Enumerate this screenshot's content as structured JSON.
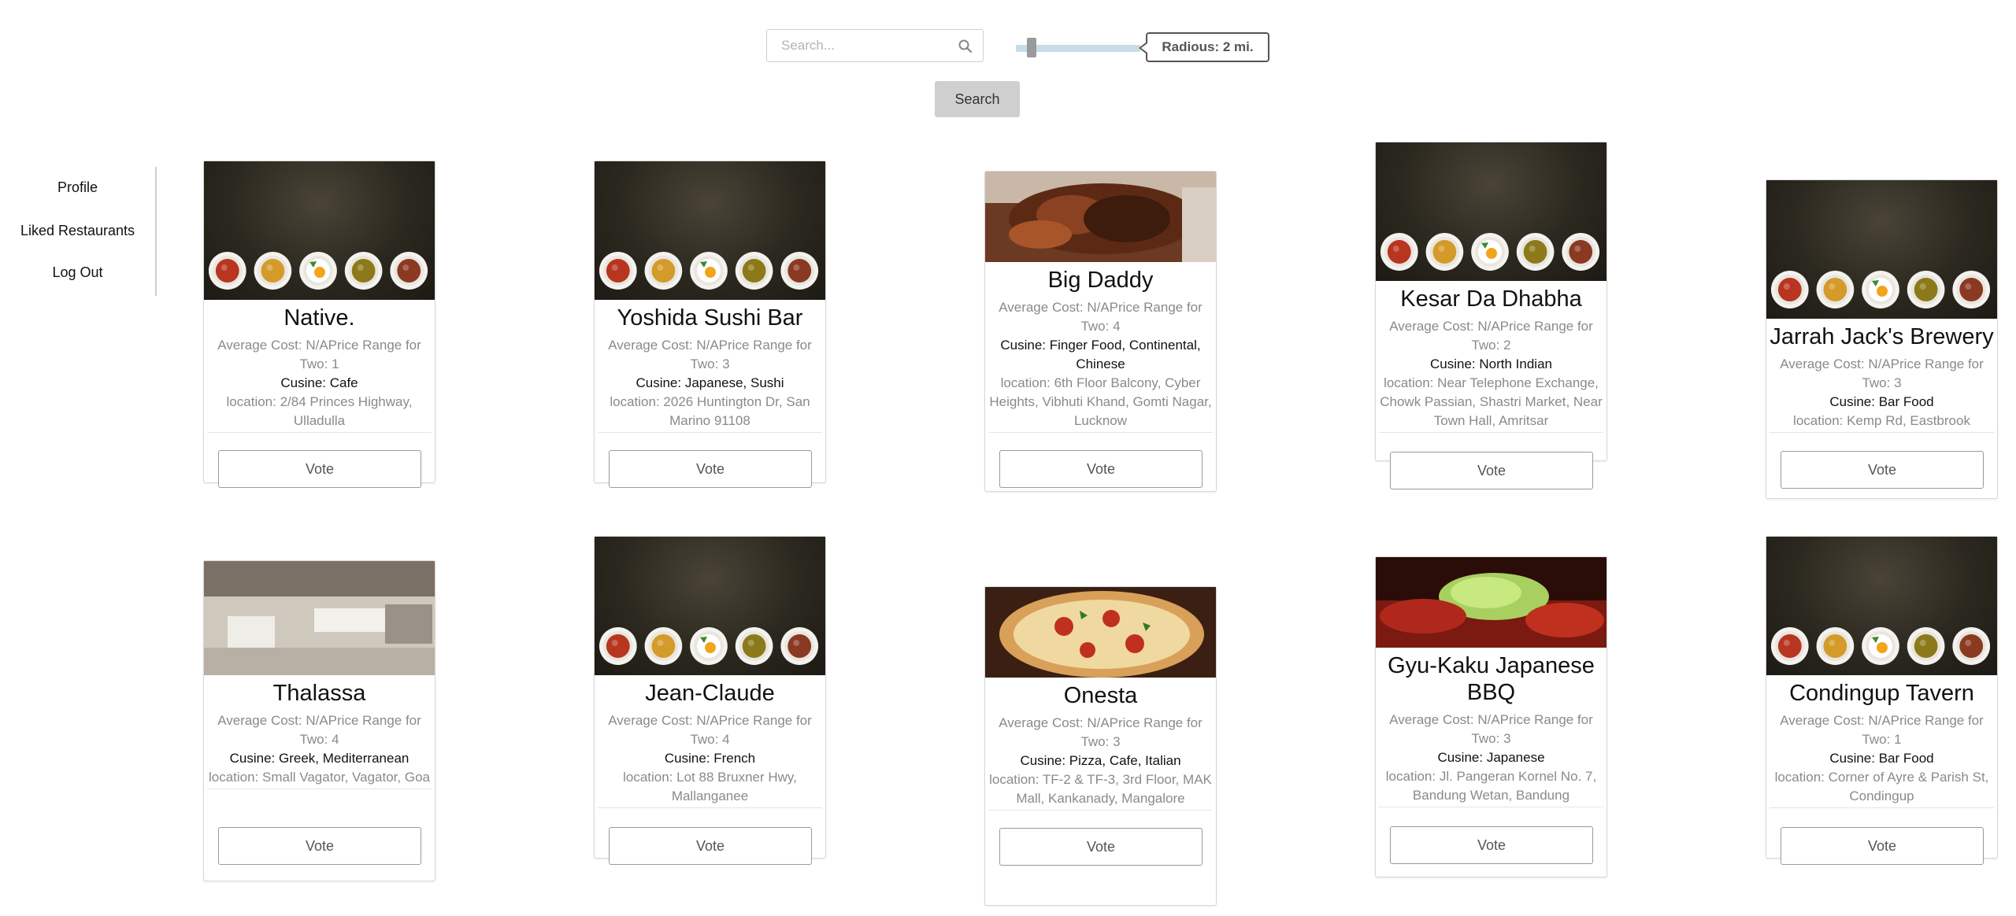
{
  "search": {
    "placeholder": "Search...",
    "button_label": "Search"
  },
  "radius": {
    "label": "Radious: 2 mi.",
    "value": 2
  },
  "sidebar": {
    "items": [
      {
        "label": "Profile"
      },
      {
        "label": "Liked Restaurants"
      },
      {
        "label": "Log Out"
      }
    ]
  },
  "cards": [
    {
      "name": "Native.",
      "cost": "Average Cost: N/APrice Range for Two: 1",
      "cuisine": "Cusine: Cafe",
      "location": "location: 2/84 Princes Highway, Ulladulla",
      "vote_label": "Vote",
      "image": "dark-plates"
    },
    {
      "name": "Yoshida Sushi Bar",
      "cost": "Average Cost: N/APrice Range for Two: 3",
      "cuisine": "Cusine: Japanese, Sushi",
      "location": "location: 2026 Huntington Dr, San Marino 91108",
      "vote_label": "Vote",
      "image": "dark-plates"
    },
    {
      "name": "Big Daddy",
      "cost": "Average Cost: N/APrice Range for Two: 4",
      "cuisine": "Cusine: Finger Food, Continental, Chinese",
      "location": "location: 6th Floor Balcony, Cyber Heights, Vibhuti Khand, Gomti Nagar, Lucknow",
      "vote_label": "Vote",
      "image": "meat-photo"
    },
    {
      "name": "Kesar Da Dhabha",
      "cost": "Average Cost: N/APrice Range for Two: 2",
      "cuisine": "Cusine: North Indian",
      "location": "location: Near Telephone Exchange, Chowk Passian, Shastri Market, Near Town Hall, Amritsar",
      "vote_label": "Vote",
      "image": "dark-plates"
    },
    {
      "name": "Jarrah Jack's Brewery",
      "cost": "Average Cost: N/APrice Range for Two: 3",
      "cuisine": "Cusine: Bar Food",
      "location": "location: Kemp Rd, Eastbrook",
      "vote_label": "Vote",
      "image": "dark-plates"
    },
    {
      "name": "Thalassa",
      "cost": "Average Cost: N/APrice Range for Two: 4",
      "cuisine": "Cusine: Greek, Mediterranean",
      "location": "location: Small Vagator, Vagator, Goa",
      "vote_label": "Vote",
      "image": "terrace-photo"
    },
    {
      "name": "Jean-Claude",
      "cost": "Average Cost: N/APrice Range for Two: 4",
      "cuisine": "Cusine: French",
      "location": "location: Lot 88 Bruxner Hwy, Mallanganee",
      "vote_label": "Vote",
      "image": "dark-plates"
    },
    {
      "name": "Onesta",
      "cost": "Average Cost: N/APrice Range for Two: 3",
      "cuisine": "Cusine: Pizza, Cafe, Italian",
      "location": "location: TF-2 & TF-3, 3rd Floor, MAK Mall, Kankanady, Mangalore",
      "vote_label": "Vote",
      "image": "pizza-photo"
    },
    {
      "name": "Gyu-Kaku Japanese BBQ",
      "cost": "Average Cost: N/APrice Range for Two: 3",
      "cuisine": "Cusine: Japanese",
      "location": "location: Jl. Pangeran Kornel No. 7, Bandung Wetan, Bandung",
      "vote_label": "Vote",
      "image": "bbq-photo"
    },
    {
      "name": "Condingup Tavern",
      "cost": "Average Cost: N/APrice Range for Two: 1",
      "cuisine": "Cusine: Bar Food",
      "location": "location: Corner of Ayre & Parish St, Condingup",
      "vote_label": "Vote",
      "image": "dark-plates"
    }
  ]
}
